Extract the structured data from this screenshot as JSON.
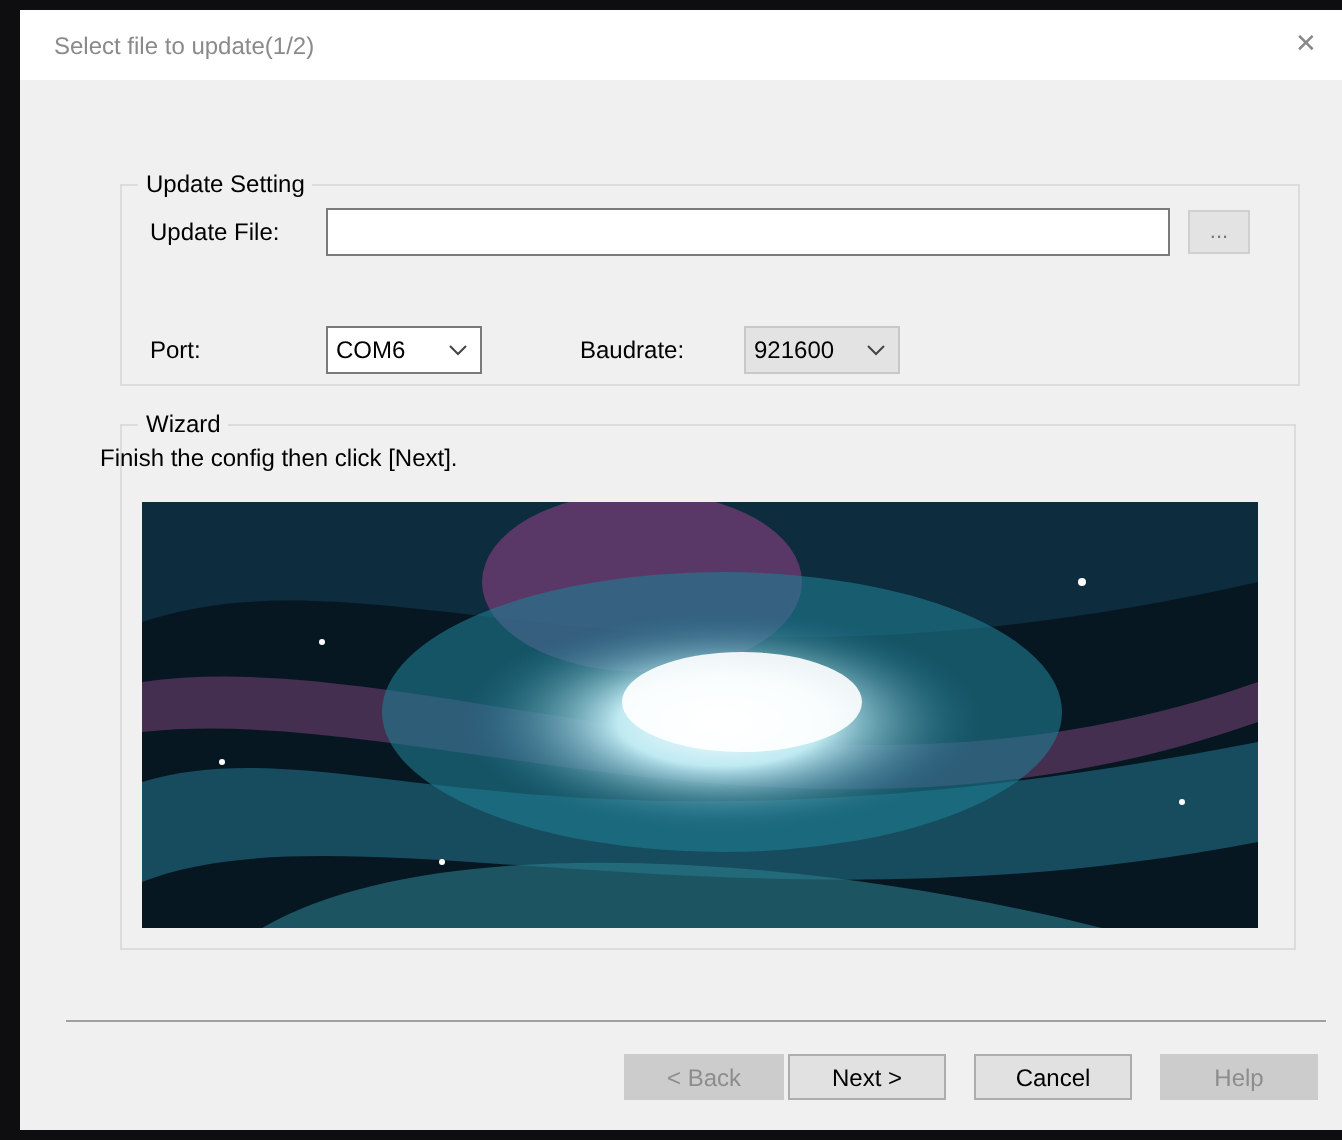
{
  "window": {
    "title": "Select file to update(1/2)",
    "close": "✕"
  },
  "update_setting": {
    "legend": "Update Setting",
    "file_label": "Update File:",
    "browse": "...",
    "port": {
      "label": "Port:",
      "value": "COM6",
      "disabled": false
    },
    "baudrate": {
      "label": "Baudrate:",
      "value": "921600",
      "disabled": true
    }
  },
  "wizard": {
    "legend": "Wizard",
    "instruction": "Finish the config then click [Next]."
  },
  "buttons": [
    {
      "label": "< Back",
      "disabled": true
    },
    {
      "label": "Next >",
      "disabled": false
    },
    {
      "label": "Cancel",
      "disabled": false
    },
    {
      "label": "Help",
      "disabled": true
    }
  ]
}
